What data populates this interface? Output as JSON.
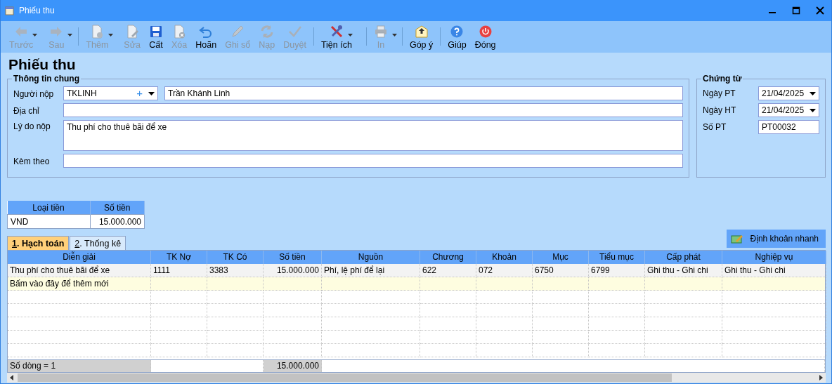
{
  "window": {
    "title": "Phiếu thu"
  },
  "toolbar": [
    {
      "label": "Trước",
      "disabled": true,
      "dropdown": true,
      "separator_after": false
    },
    {
      "label": "Sau",
      "disabled": true,
      "dropdown": true,
      "separator_after": true
    },
    {
      "label": "Thêm",
      "disabled": true,
      "dropdown": true,
      "separator_after": false
    },
    {
      "label": "Sửa",
      "disabled": true,
      "dropdown": false,
      "separator_after": false
    },
    {
      "label": "Cất",
      "disabled": false,
      "dropdown": false,
      "separator_after": false
    },
    {
      "label": "Xóa",
      "disabled": true,
      "dropdown": false,
      "separator_after": false
    },
    {
      "label": "Hoãn",
      "disabled": false,
      "dropdown": false,
      "separator_after": false
    },
    {
      "label": "Ghi sổ",
      "disabled": true,
      "dropdown": false,
      "separator_after": false
    },
    {
      "label": "Nạp",
      "disabled": true,
      "dropdown": false,
      "separator_after": false
    },
    {
      "label": "Duyệt",
      "disabled": true,
      "dropdown": false,
      "separator_after": true
    },
    {
      "label": "Tiện ích",
      "disabled": false,
      "dropdown": true,
      "separator_after": true
    },
    {
      "label": "In",
      "disabled": true,
      "dropdown": true,
      "separator_after": true
    },
    {
      "label": "Góp ý",
      "disabled": false,
      "dropdown": false,
      "separator_after": true
    },
    {
      "label": "Giúp",
      "disabled": false,
      "dropdown": false,
      "separator_after": false
    },
    {
      "label": "Đóng",
      "disabled": false,
      "dropdown": false,
      "separator_after": false
    }
  ],
  "page_title": "Phiếu thu",
  "general_info": {
    "title": "Thông tin chung",
    "payer": {
      "label": "Người nộp",
      "code": "TKLINH",
      "add_symbol": "+",
      "name": "Trần Khánh Linh"
    },
    "fields": [
      {
        "label": "Địa chỉ",
        "kind": "line"
      },
      {
        "label": "Lý do nộp",
        "value": "Thu phí cho thuê bãi để xe",
        "kind": "multiline"
      },
      {
        "label": "Kèm theo",
        "kind": "line"
      }
    ]
  },
  "voucher": {
    "title": "Chứng từ",
    "fields": [
      {
        "label": "Ngày PT",
        "value": "21/04/2025",
        "kind": "date"
      },
      {
        "label": "Ngày HT",
        "value": "21/04/2025",
        "kind": "date"
      },
      {
        "label": "Số PT",
        "value": "PT00032",
        "kind": "text"
      }
    ]
  },
  "currency_table": {
    "columns": [
      "Loại tiền",
      "Số tiền"
    ],
    "rows": [
      [
        "VND",
        "15.000.000"
      ]
    ]
  },
  "tabs": [
    {
      "shortcut": "1",
      "label": ". Hạch toán",
      "selected": true
    },
    {
      "shortcut": "2",
      "label": ". Thống kê",
      "selected": false
    }
  ],
  "quick_entry_button": "Định khoản nhanh",
  "grid": {
    "columns": [
      {
        "label": "Diễn giải",
        "kind": "text"
      },
      {
        "label": "TK Nợ",
        "kind": "text"
      },
      {
        "label": "TK Có",
        "kind": "text"
      },
      {
        "label": "Số tiền",
        "kind": "number"
      },
      {
        "label": "Nguồn",
        "kind": "text"
      },
      {
        "label": "Chương",
        "kind": "text"
      },
      {
        "label": "Khoản",
        "kind": "text"
      },
      {
        "label": "Mục",
        "kind": "text"
      },
      {
        "label": "Tiểu mục",
        "kind": "text"
      },
      {
        "label": "Cấp phát",
        "kind": "text"
      },
      {
        "label": "Nghiệp vụ",
        "kind": "text"
      }
    ],
    "rows": [
      [
        "Thu phí cho thuê bãi để xe",
        "1111",
        "3383",
        "15.000.000",
        "Phí, lệ phí để lại",
        "622",
        "072",
        "6750",
        "6799",
        "Ghi thu - Ghi chi",
        "Ghi thu - Ghi chi"
      ]
    ],
    "new_row_hint": "Bấm vào đây để thêm mới",
    "footer": {
      "row_count": "Số dòng = 1",
      "total": "15.000.000"
    }
  }
}
